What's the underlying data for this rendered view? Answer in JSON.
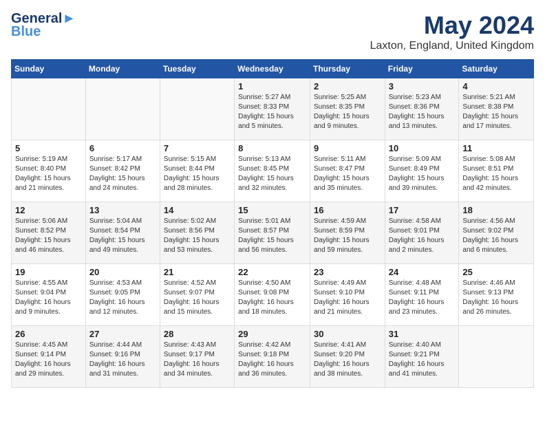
{
  "header": {
    "logo_line1": "General",
    "logo_line2": "Blue",
    "month": "May 2024",
    "location": "Laxton, England, United Kingdom"
  },
  "weekdays": [
    "Sunday",
    "Monday",
    "Tuesday",
    "Wednesday",
    "Thursday",
    "Friday",
    "Saturday"
  ],
  "weeks": [
    [
      {
        "day": "",
        "sunrise": "",
        "sunset": "",
        "daylight": ""
      },
      {
        "day": "",
        "sunrise": "",
        "sunset": "",
        "daylight": ""
      },
      {
        "day": "",
        "sunrise": "",
        "sunset": "",
        "daylight": ""
      },
      {
        "day": "1",
        "sunrise": "Sunrise: 5:27 AM",
        "sunset": "Sunset: 8:33 PM",
        "daylight": "Daylight: 15 hours and 5 minutes."
      },
      {
        "day": "2",
        "sunrise": "Sunrise: 5:25 AM",
        "sunset": "Sunset: 8:35 PM",
        "daylight": "Daylight: 15 hours and 9 minutes."
      },
      {
        "day": "3",
        "sunrise": "Sunrise: 5:23 AM",
        "sunset": "Sunset: 8:36 PM",
        "daylight": "Daylight: 15 hours and 13 minutes."
      },
      {
        "day": "4",
        "sunrise": "Sunrise: 5:21 AM",
        "sunset": "Sunset: 8:38 PM",
        "daylight": "Daylight: 15 hours and 17 minutes."
      }
    ],
    [
      {
        "day": "5",
        "sunrise": "Sunrise: 5:19 AM",
        "sunset": "Sunset: 8:40 PM",
        "daylight": "Daylight: 15 hours and 21 minutes."
      },
      {
        "day": "6",
        "sunrise": "Sunrise: 5:17 AM",
        "sunset": "Sunset: 8:42 PM",
        "daylight": "Daylight: 15 hours and 24 minutes."
      },
      {
        "day": "7",
        "sunrise": "Sunrise: 5:15 AM",
        "sunset": "Sunset: 8:44 PM",
        "daylight": "Daylight: 15 hours and 28 minutes."
      },
      {
        "day": "8",
        "sunrise": "Sunrise: 5:13 AM",
        "sunset": "Sunset: 8:45 PM",
        "daylight": "Daylight: 15 hours and 32 minutes."
      },
      {
        "day": "9",
        "sunrise": "Sunrise: 5:11 AM",
        "sunset": "Sunset: 8:47 PM",
        "daylight": "Daylight: 15 hours and 35 minutes."
      },
      {
        "day": "10",
        "sunrise": "Sunrise: 5:09 AM",
        "sunset": "Sunset: 8:49 PM",
        "daylight": "Daylight: 15 hours and 39 minutes."
      },
      {
        "day": "11",
        "sunrise": "Sunrise: 5:08 AM",
        "sunset": "Sunset: 8:51 PM",
        "daylight": "Daylight: 15 hours and 42 minutes."
      }
    ],
    [
      {
        "day": "12",
        "sunrise": "Sunrise: 5:06 AM",
        "sunset": "Sunset: 8:52 PM",
        "daylight": "Daylight: 15 hours and 46 minutes."
      },
      {
        "day": "13",
        "sunrise": "Sunrise: 5:04 AM",
        "sunset": "Sunset: 8:54 PM",
        "daylight": "Daylight: 15 hours and 49 minutes."
      },
      {
        "day": "14",
        "sunrise": "Sunrise: 5:02 AM",
        "sunset": "Sunset: 8:56 PM",
        "daylight": "Daylight: 15 hours and 53 minutes."
      },
      {
        "day": "15",
        "sunrise": "Sunrise: 5:01 AM",
        "sunset": "Sunset: 8:57 PM",
        "daylight": "Daylight: 15 hours and 56 minutes."
      },
      {
        "day": "16",
        "sunrise": "Sunrise: 4:59 AM",
        "sunset": "Sunset: 8:59 PM",
        "daylight": "Daylight: 15 hours and 59 minutes."
      },
      {
        "day": "17",
        "sunrise": "Sunrise: 4:58 AM",
        "sunset": "Sunset: 9:01 PM",
        "daylight": "Daylight: 16 hours and 2 minutes."
      },
      {
        "day": "18",
        "sunrise": "Sunrise: 4:56 AM",
        "sunset": "Sunset: 9:02 PM",
        "daylight": "Daylight: 16 hours and 6 minutes."
      }
    ],
    [
      {
        "day": "19",
        "sunrise": "Sunrise: 4:55 AM",
        "sunset": "Sunset: 9:04 PM",
        "daylight": "Daylight: 16 hours and 9 minutes."
      },
      {
        "day": "20",
        "sunrise": "Sunrise: 4:53 AM",
        "sunset": "Sunset: 9:05 PM",
        "daylight": "Daylight: 16 hours and 12 minutes."
      },
      {
        "day": "21",
        "sunrise": "Sunrise: 4:52 AM",
        "sunset": "Sunset: 9:07 PM",
        "daylight": "Daylight: 16 hours and 15 minutes."
      },
      {
        "day": "22",
        "sunrise": "Sunrise: 4:50 AM",
        "sunset": "Sunset: 9:08 PM",
        "daylight": "Daylight: 16 hours and 18 minutes."
      },
      {
        "day": "23",
        "sunrise": "Sunrise: 4:49 AM",
        "sunset": "Sunset: 9:10 PM",
        "daylight": "Daylight: 16 hours and 21 minutes."
      },
      {
        "day": "24",
        "sunrise": "Sunrise: 4:48 AM",
        "sunset": "Sunset: 9:11 PM",
        "daylight": "Daylight: 16 hours and 23 minutes."
      },
      {
        "day": "25",
        "sunrise": "Sunrise: 4:46 AM",
        "sunset": "Sunset: 9:13 PM",
        "daylight": "Daylight: 16 hours and 26 minutes."
      }
    ],
    [
      {
        "day": "26",
        "sunrise": "Sunrise: 4:45 AM",
        "sunset": "Sunset: 9:14 PM",
        "daylight": "Daylight: 16 hours and 29 minutes."
      },
      {
        "day": "27",
        "sunrise": "Sunrise: 4:44 AM",
        "sunset": "Sunset: 9:16 PM",
        "daylight": "Daylight: 16 hours and 31 minutes."
      },
      {
        "day": "28",
        "sunrise": "Sunrise: 4:43 AM",
        "sunset": "Sunset: 9:17 PM",
        "daylight": "Daylight: 16 hours and 34 minutes."
      },
      {
        "day": "29",
        "sunrise": "Sunrise: 4:42 AM",
        "sunset": "Sunset: 9:18 PM",
        "daylight": "Daylight: 16 hours and 36 minutes."
      },
      {
        "day": "30",
        "sunrise": "Sunrise: 4:41 AM",
        "sunset": "Sunset: 9:20 PM",
        "daylight": "Daylight: 16 hours and 38 minutes."
      },
      {
        "day": "31",
        "sunrise": "Sunrise: 4:40 AM",
        "sunset": "Sunset: 9:21 PM",
        "daylight": "Daylight: 16 hours and 41 minutes."
      },
      {
        "day": "",
        "sunrise": "",
        "sunset": "",
        "daylight": ""
      }
    ]
  ]
}
